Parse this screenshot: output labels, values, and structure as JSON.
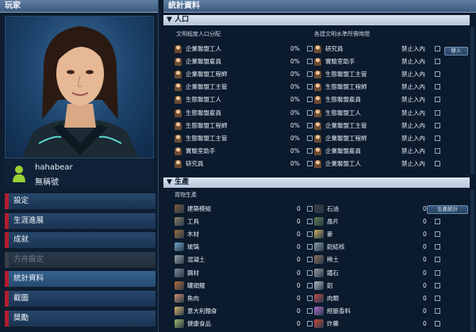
{
  "left": {
    "header": "玩家",
    "player_name": "hahabear",
    "player_tag": "無稱號",
    "menu": [
      {
        "label": "設定",
        "state": "normal"
      },
      {
        "label": "生涯進展",
        "state": "normal"
      },
      {
        "label": "成就",
        "state": "normal"
      },
      {
        "label": "方舟設定",
        "state": "disabled"
      },
      {
        "label": "統計資料",
        "state": "active"
      },
      {
        "label": "截圖",
        "state": "normal"
      },
      {
        "label": "獎勵",
        "state": "normal"
      }
    ]
  },
  "right": {
    "header": "統計資料",
    "population": {
      "title": "人口",
      "left_sub": "文明程度人口分配",
      "right_sub": "各建文明水準所需時間",
      "left_rows": [
        {
          "label": "企業聯盟工人",
          "value": "0%"
        },
        {
          "label": "企業聯盟雇員",
          "value": "0%"
        },
        {
          "label": "企業聯盟工程師",
          "value": "0%"
        },
        {
          "label": "企業聯盟工主管",
          "value": "0%"
        },
        {
          "label": "生態聯盟工人",
          "value": "0%"
        },
        {
          "label": "生態聯盟雇員",
          "value": "0%"
        },
        {
          "label": "生態聯盟工程師",
          "value": "0%"
        },
        {
          "label": "生態聯盟工主管",
          "value": "0%"
        },
        {
          "label": "實驗室助手",
          "value": "0%"
        },
        {
          "label": "研究員",
          "value": "0%"
        }
      ],
      "right_rows": [
        {
          "label": "研究員",
          "value": "禁止入內"
        },
        {
          "label": "實驗室助手",
          "value": "禁止入內"
        },
        {
          "label": "生態聯盟工主管",
          "value": "禁止入內"
        },
        {
          "label": "生態聯盟工程師",
          "value": "禁止入內"
        },
        {
          "label": "生態聯盟雇員",
          "value": "禁止入內"
        },
        {
          "label": "生態聯盟工人",
          "value": "禁止入內"
        },
        {
          "label": "企業聯盟工主管",
          "value": "禁止入內"
        },
        {
          "label": "企業聯盟工程師",
          "value": "禁止入內"
        },
        {
          "label": "企業聯盟雇員",
          "value": "禁止入內"
        },
        {
          "label": "企業聯盟工人",
          "value": "禁止入內"
        }
      ],
      "side_button": "移入"
    },
    "production": {
      "title": "生產",
      "sub": "貨物生產",
      "left_rows": [
        {
          "label": "建築模組",
          "value": "0",
          "color": "#7a5b3a"
        },
        {
          "label": "工具",
          "value": "0",
          "color": "#8a7c62"
        },
        {
          "label": "木材",
          "value": "0",
          "color": "#9a6b3a"
        },
        {
          "label": "玻璃",
          "value": "0",
          "color": "#6fa6c9"
        },
        {
          "label": "混凝土",
          "value": "0",
          "color": "#9aa0a6"
        },
        {
          "label": "鋼材",
          "value": "0",
          "color": "#7d8794"
        },
        {
          "label": "罐頭鰻",
          "value": "0",
          "color": "#b86b3a"
        },
        {
          "label": "魚肉",
          "value": "0",
          "color": "#c98d6a"
        },
        {
          "label": "意大利麵食",
          "value": "0",
          "color": "#d3b26a"
        },
        {
          "label": "健康食品",
          "value": "0",
          "color": "#9cb86a"
        }
      ],
      "right_rows": [
        {
          "label": "石油",
          "value": "0",
          "color": "#3a3a3a"
        },
        {
          "label": "晶片",
          "value": "0",
          "color": "#5a7a4a"
        },
        {
          "label": "麥",
          "value": "0",
          "color": "#c9a85a"
        },
        {
          "label": "鋁結核",
          "value": "0",
          "color": "#8a9aa6"
        },
        {
          "label": "稀土",
          "value": "0",
          "color": "#8a6a5a"
        },
        {
          "label": "鐵石",
          "value": "0",
          "color": "#9a9a9a"
        },
        {
          "label": "鋁",
          "value": "0",
          "color": "#b0b8c0"
        },
        {
          "label": "肉類",
          "value": "0",
          "color": "#b84a4a"
        },
        {
          "label": "經脈香料",
          "value": "0",
          "color": "#a86ac9"
        },
        {
          "label": "炸藥",
          "value": "0",
          "color": "#c94a3a"
        }
      ],
      "side_button": "生產統計"
    }
  }
}
